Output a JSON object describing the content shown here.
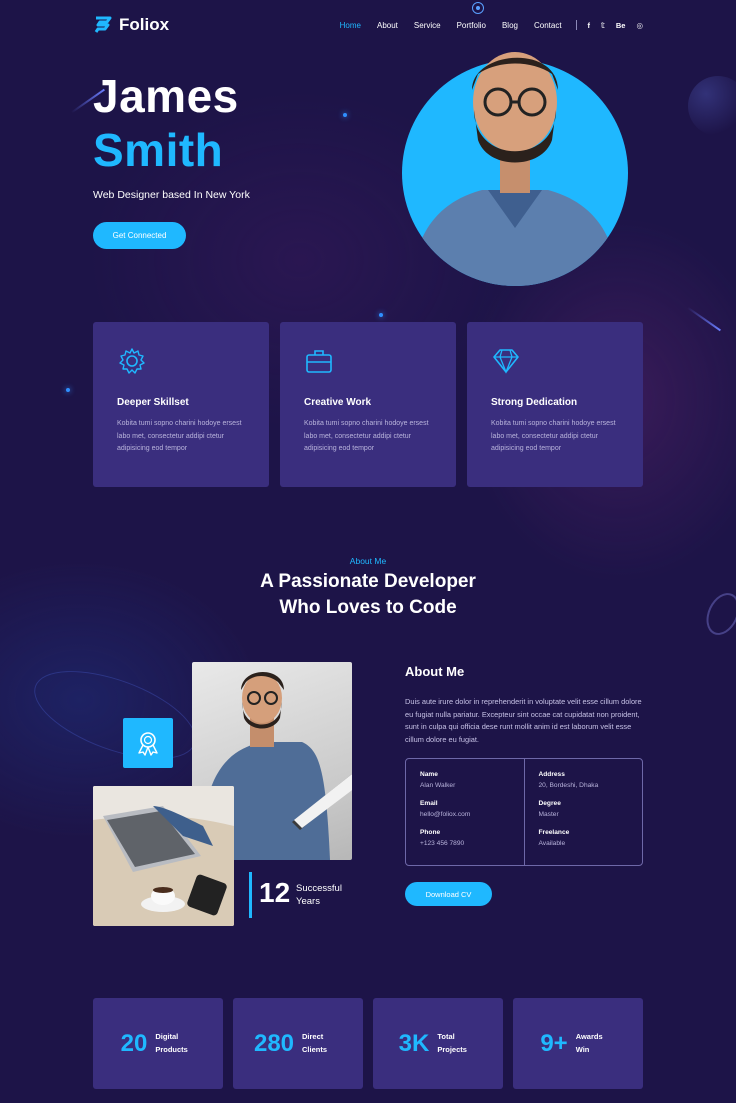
{
  "brand": {
    "name": "Foliox",
    "accent": "#1fb8ff",
    "background": "#1d1448",
    "card": "#3a2e7e"
  },
  "nav": {
    "items": [
      {
        "label": "Home",
        "active": true
      },
      {
        "label": "About",
        "active": false
      },
      {
        "label": "Service",
        "active": false
      },
      {
        "label": "Portfolio",
        "active": false
      },
      {
        "label": "Blog",
        "active": false
      },
      {
        "label": "Contact",
        "active": false
      }
    ],
    "social": [
      {
        "label": "f",
        "icon": "facebook-icon"
      },
      {
        "label": "𝕥",
        "icon": "twitter-icon"
      },
      {
        "label": "Be",
        "icon": "behance-icon"
      },
      {
        "label": "◎",
        "icon": "dribbble-icon"
      }
    ]
  },
  "hero": {
    "first_name": "James",
    "last_name": "Smith",
    "subtitle": "Web Designer based In New York",
    "cta_label": "Get Connected"
  },
  "features": [
    {
      "icon": "gear-icon",
      "title": "Deeper Skillset",
      "text": "Kobita tumi sopno charini hodoye ersest labo met, consectetur addipi ctetur adipisicing eod tempor"
    },
    {
      "icon": "briefcase-icon",
      "title": "Creative Work",
      "text": "Kobita tumi sopno charini hodoye ersest labo met, consectetur addipi ctetur adipisicing eod tempor"
    },
    {
      "icon": "diamond-icon",
      "title": "Strong Dedication",
      "text": "Kobita tumi sopno charini hodoye ersest labo met, consectetur addipi ctetur adipisicing eod tempor"
    }
  ],
  "about_section": {
    "eyebrow": "About Me",
    "title_line1": "A Passionate Developer",
    "title_line2": "Who Loves to Code",
    "years_number": "12",
    "years_label": "Successful Years",
    "heading": "About Me",
    "paragraph": "Duis aute irure dolor in reprehenderit in voluptate velit esse cillum dolore eu fugiat nulla pariatur. Excepteur sint occae cat cupidatat non proident, sunt in culpa qui officia dese runt mollit anim id est laborum velit esse cillum dolore eu fugiat.",
    "info_left": [
      {
        "label": "Name",
        "value": "Alan Walker"
      },
      {
        "label": "Email",
        "value": "hello@foliox.com"
      },
      {
        "label": "Phone",
        "value": "+123 456 7890"
      }
    ],
    "info_right": [
      {
        "label": "Address",
        "value": "20, Bordeshi, Dhaka"
      },
      {
        "label": "Degree",
        "value": "Master"
      },
      {
        "label": "Freelance",
        "value": "Available"
      }
    ],
    "cv_label": "Download CV"
  },
  "stats": [
    {
      "number": "20",
      "label": "Digital Products"
    },
    {
      "number": "280",
      "label": "Direct Clients"
    },
    {
      "number": "3K",
      "label": "Total Projects"
    },
    {
      "number": "9+",
      "label": "Awards Win"
    }
  ]
}
